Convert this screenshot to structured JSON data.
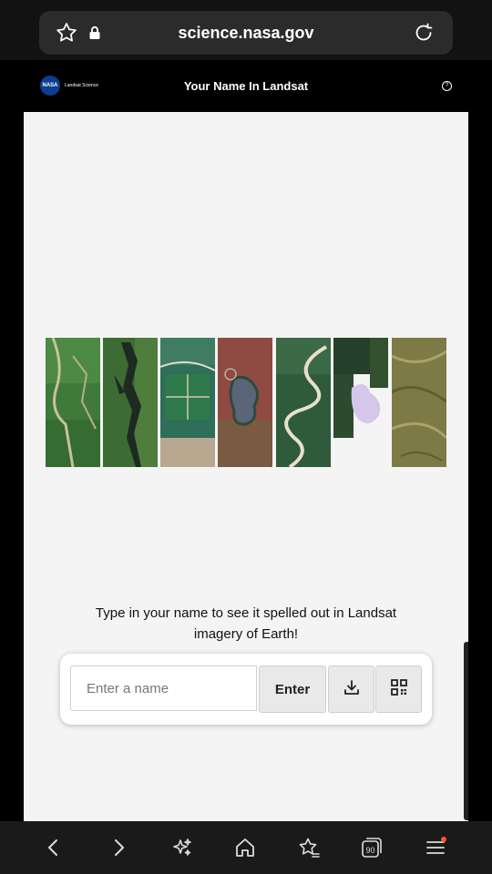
{
  "browser": {
    "url": "science.nasa.gov",
    "tabs_count": "90"
  },
  "site": {
    "logo_mark": "NASA",
    "logo_text": "Landsat Science",
    "title": "Your Name In Landsat",
    "help_glyph": "?"
  },
  "main": {
    "prompt": "Type in your name to see it spelled out in Landsat imagery of Earth!",
    "input_placeholder": "Enter a name",
    "input_value": "",
    "enter_label": "Enter",
    "letter_images": [
      {
        "icon": "satellite-image-river-green"
      },
      {
        "icon": "satellite-image-dark-lake"
      },
      {
        "icon": "satellite-image-fields"
      },
      {
        "icon": "satellite-image-red-lake"
      },
      {
        "icon": "satellite-image-meander-river"
      },
      {
        "icon": "satellite-image-snow-lake"
      },
      {
        "icon": "satellite-image-olive-hills"
      }
    ]
  },
  "colors": {
    "site_header": "#000000",
    "page_background": "#f4f4f4",
    "notification_dot": "#ff5722"
  }
}
